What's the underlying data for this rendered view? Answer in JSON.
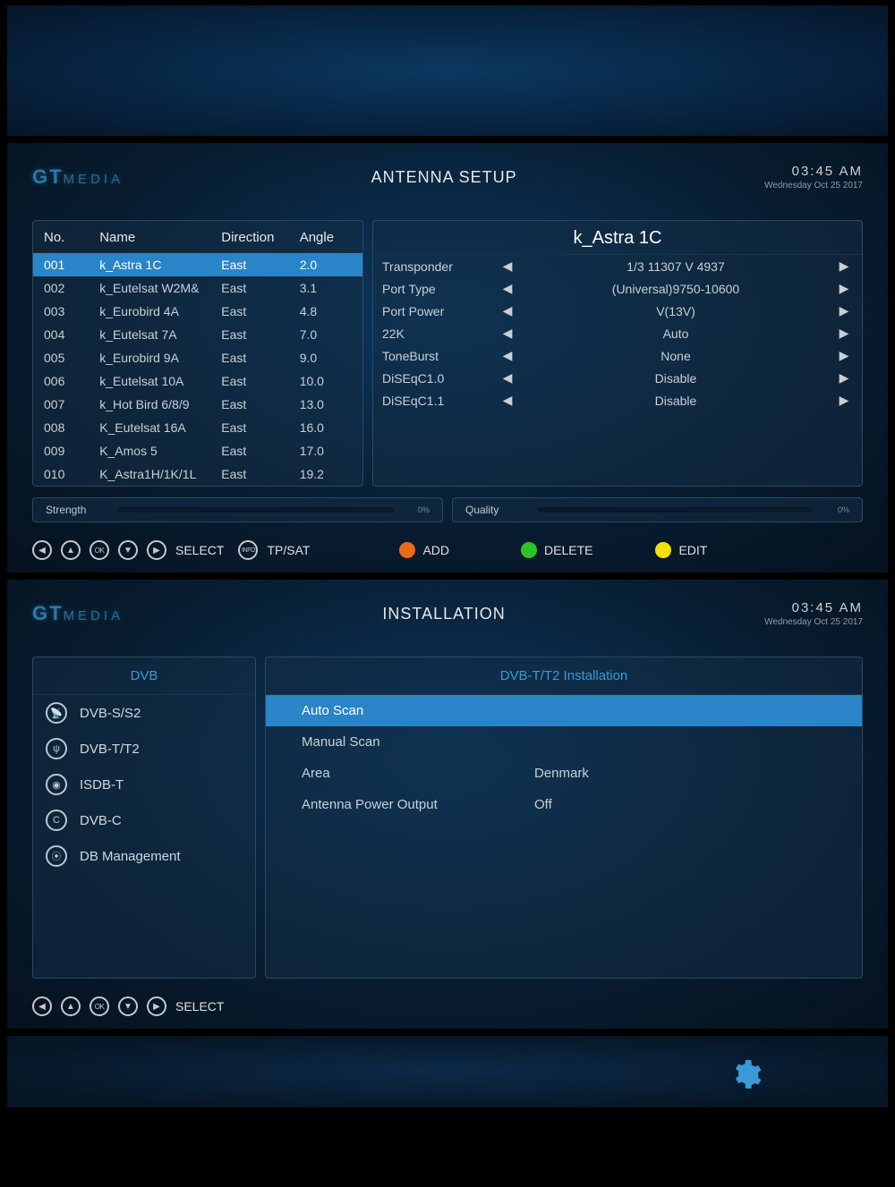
{
  "brand": {
    "logo_main": "GT",
    "logo_sub": "MEDIA"
  },
  "clock": {
    "time": "03:45 AM",
    "date": "Wednesday  Oct 25 2017"
  },
  "antenna": {
    "title": "ANTENNA SETUP",
    "columns": {
      "no": "No.",
      "name": "Name",
      "direction": "Direction",
      "angle": "Angle"
    },
    "rows": [
      {
        "no": "001",
        "name": "k_Astra 1C",
        "direction": "East",
        "angle": "2.0"
      },
      {
        "no": "002",
        "name": "k_Eutelsat W2M&",
        "direction": "East",
        "angle": "3.1"
      },
      {
        "no": "003",
        "name": "k_Eurobird 4A",
        "direction": "East",
        "angle": "4.8"
      },
      {
        "no": "004",
        "name": "k_Eutelsat 7A",
        "direction": "East",
        "angle": "7.0"
      },
      {
        "no": "005",
        "name": "k_Eurobird 9A",
        "direction": "East",
        "angle": "9.0"
      },
      {
        "no": "006",
        "name": "k_Eutelsat 10A",
        "direction": "East",
        "angle": "10.0"
      },
      {
        "no": "007",
        "name": "k_Hot Bird 6/8/9",
        "direction": "East",
        "angle": "13.0"
      },
      {
        "no": "008",
        "name": "K_Eutelsat 16A",
        "direction": "East",
        "angle": "16.0"
      },
      {
        "no": "009",
        "name": "K_Amos 5",
        "direction": "East",
        "angle": "17.0"
      },
      {
        "no": "010",
        "name": "K_Astra1H/1K/1L",
        "direction": "East",
        "angle": "19.2"
      }
    ],
    "selected_name": "k_Astra 1C",
    "details": [
      {
        "label": "Transponder",
        "value": "1/3 11307 V 4937"
      },
      {
        "label": "Port Type",
        "value": "(Universal)9750-10600"
      },
      {
        "label": "Port Power",
        "value": "V(13V)"
      },
      {
        "label": "22K",
        "value": "Auto"
      },
      {
        "label": "ToneBurst",
        "value": "None"
      },
      {
        "label": "DiSEqC1.0",
        "value": "Disable"
      },
      {
        "label": "DiSEqC1.1",
        "value": "Disable"
      }
    ],
    "bars": {
      "strength_label": "Strength",
      "strength_pct": "0%",
      "quality_label": "Quality",
      "quality_pct": "0%"
    },
    "toolbar": {
      "select": "SELECT",
      "tpsat": "TP/SAT",
      "add": "ADD",
      "delete": "DELETE",
      "edit": "EDIT",
      "info": "INFO",
      "ok": "OK"
    },
    "colors": {
      "add": "#e86a1a",
      "delete": "#2cc22c",
      "edit": "#f2e20a"
    }
  },
  "install": {
    "title": "INSTALLATION",
    "side_title": "DVB",
    "side_items": [
      "DVB-S/S2",
      "DVB-T/T2",
      "ISDB-T",
      "DVB-C",
      "DB Management"
    ],
    "main_title": "DVB-T/T2 Installation",
    "options": [
      {
        "label": "Auto Scan",
        "value": ""
      },
      {
        "label": "Manual Scan",
        "value": ""
      },
      {
        "label": "Area",
        "value": "Denmark"
      },
      {
        "label": "Antenna Power Output",
        "value": "Off"
      }
    ],
    "toolbar": {
      "select": "SELECT",
      "ok": "OK"
    }
  }
}
